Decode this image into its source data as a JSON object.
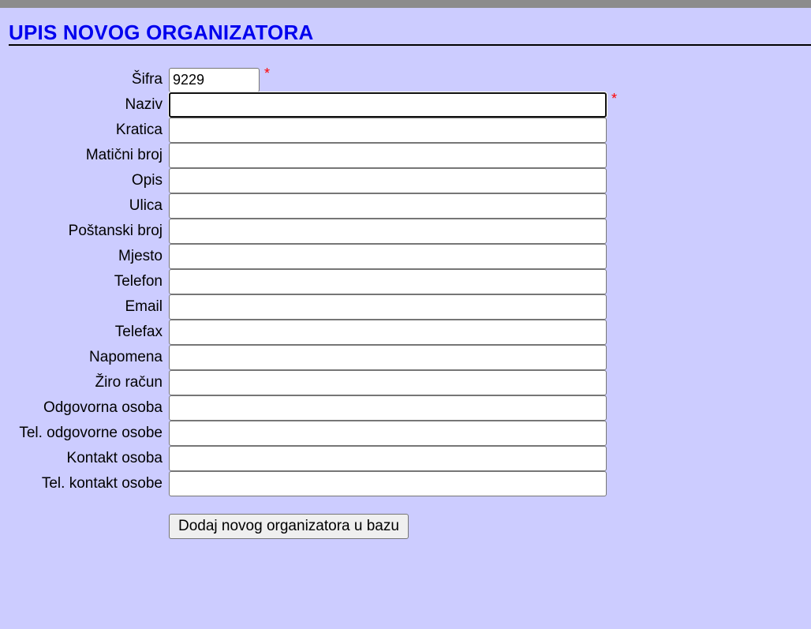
{
  "page": {
    "title": "UPIS NOVOG ORGANIZATORA"
  },
  "colors": {
    "background": "#ccccff",
    "title": "#0000ee",
    "required": "#ff0000"
  },
  "form": {
    "fields": [
      {
        "label": "Šifra",
        "value": "9229",
        "required": true
      },
      {
        "label": "Naziv",
        "value": "",
        "required": true,
        "focused": true
      },
      {
        "label": "Kratica",
        "value": ""
      },
      {
        "label": "Matični broj",
        "value": ""
      },
      {
        "label": "Opis",
        "value": ""
      },
      {
        "label": "Ulica",
        "value": ""
      },
      {
        "label": "Poštanski broj",
        "value": ""
      },
      {
        "label": "Mjesto",
        "value": ""
      },
      {
        "label": "Telefon",
        "value": ""
      },
      {
        "label": "Email",
        "value": ""
      },
      {
        "label": "Telefax",
        "value": ""
      },
      {
        "label": "Napomena",
        "value": ""
      },
      {
        "label": "Žiro račun",
        "value": ""
      },
      {
        "label": "Odgovorna osoba",
        "value": ""
      },
      {
        "label": "Tel. odgovorne osobe",
        "value": ""
      },
      {
        "label": "Kontakt osoba",
        "value": ""
      },
      {
        "label": "Tel. kontakt osobe",
        "value": ""
      }
    ],
    "required_marker": "*",
    "submit_label": "Dodaj novog organizatora u bazu"
  }
}
